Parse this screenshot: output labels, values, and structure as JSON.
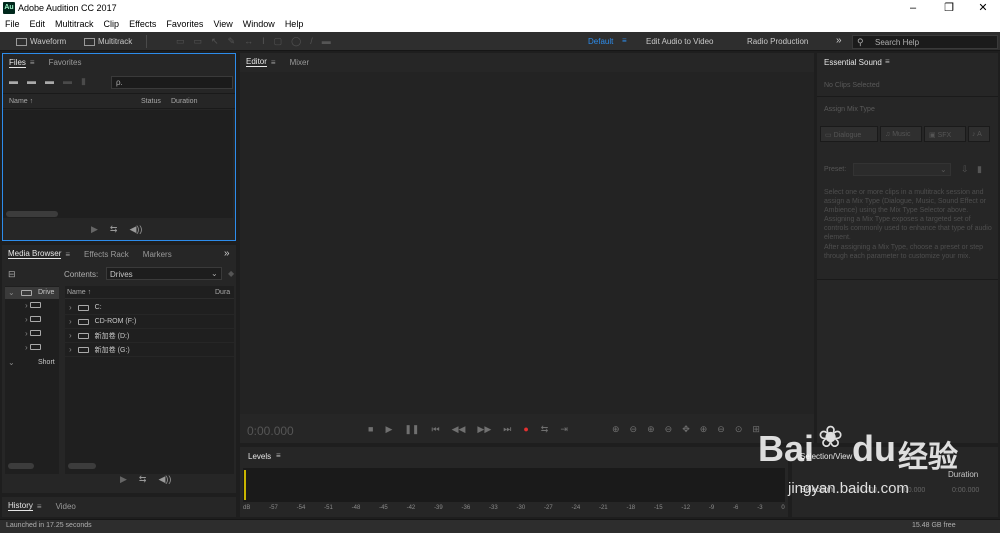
{
  "window": {
    "title": "Adobe Audition CC 2017",
    "icon_text": "Au"
  },
  "menu": [
    "File",
    "Edit",
    "Multitrack",
    "Clip",
    "Effects",
    "Favorites",
    "View",
    "Window",
    "Help"
  ],
  "toolbar": {
    "waveform_label": "Waveform",
    "multitrack_label": "Multitrack",
    "workspaces": [
      "Default",
      "Edit Audio to Video",
      "Radio Production"
    ],
    "overflow": "»",
    "search_placeholder": "Search Help"
  },
  "files_panel": {
    "tabs": [
      "Files",
      "Favorites"
    ],
    "search_icon": "ρ.",
    "columns": [
      "Name ↑",
      "Status",
      "Duration"
    ]
  },
  "media_panel": {
    "tabs": [
      "Media Browser",
      "Effects Rack",
      "Markers"
    ],
    "contents_label": "Contents:",
    "contents_value": "Drives",
    "left_tree": [
      {
        "label": "Drive",
        "expanded": true
      },
      {
        "label": "Short",
        "expanded": true
      }
    ],
    "columns": [
      "Name ↑",
      "Dura"
    ],
    "drives": [
      "C:",
      "CD-ROM (F:)",
      "新加卷 (D:)",
      "新加卷 (G:)"
    ]
  },
  "bottom_tabs": [
    "History",
    "Video"
  ],
  "editor": {
    "tabs": [
      "Editor",
      "Mixer"
    ],
    "time": "0:00.000"
  },
  "levels": {
    "title": "Levels",
    "scale": [
      "dB",
      "-57",
      "-54",
      "-51",
      "-48",
      "-45",
      "-42",
      "-39",
      "-36",
      "-33",
      "-30",
      "-27",
      "-24",
      "-21",
      "-18",
      "-15",
      "-12",
      "-9",
      "-6",
      "-3",
      "0"
    ]
  },
  "selection_view": {
    "title": "Selection/View",
    "duration_label": "Duration",
    "row_label": "Selection",
    "values": [
      "0:00.000",
      "0:00.000",
      "0:00.000"
    ]
  },
  "essential_sound": {
    "title": "Essential Sound",
    "no_clips": "No Clips Selected",
    "assign": "Assign Mix Type",
    "types": [
      "Dialogue",
      "Music",
      "SFX",
      "A"
    ],
    "preset_label": "Preset:",
    "help": "Select one or more clips in a multitrack session and assign a Mix Type (Dialogue, Music, Sound Effect or Ambience) using the Mix Type Selector above. Assigning a Mix Type exposes a targeted set of controls commonly used to enhance that type of audio element.",
    "help2": "After assigning a Mix Type, choose a preset or step through each parameter to customize your mix."
  },
  "status": {
    "left": "Launched in 17.25 seconds",
    "right": "15.48 GB free"
  },
  "watermark": {
    "brand": "Bai",
    "brand2": "du",
    "cn": "经验",
    "url": "jingyan.baidu.com"
  },
  "colors": {
    "accent": "#2d8ceb",
    "record": "#e53030",
    "playhead": "#c8b400"
  }
}
